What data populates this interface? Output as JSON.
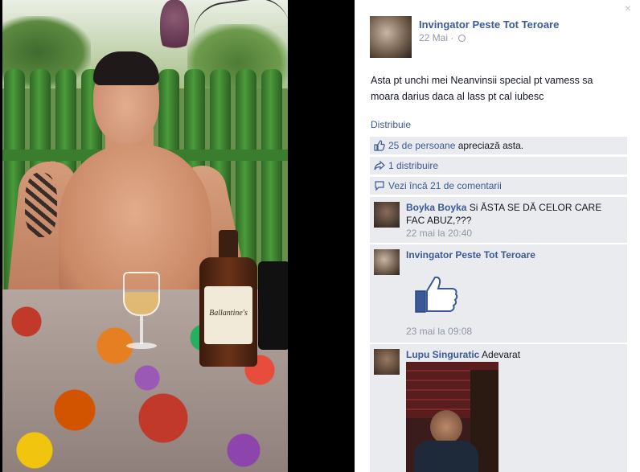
{
  "photo": {
    "bottle_label": "Ballantine's"
  },
  "viewer": {
    "close_glyph": "×"
  },
  "post": {
    "author": "Invingator Peste Tot Teroare",
    "date": "22 Mai",
    "separator": " · ",
    "text": "Asta pt unchi mei Neanvinsii special pt vamess sa moara darius daca al lass pt cal iubesc",
    "share_label": "Distribuie"
  },
  "ufi": {
    "likes_link": "25 de persoane",
    "likes_suffix": " apreciază asta.",
    "shares_label": "1 distribuire",
    "more_comments_label": "Vezi încă 21 de comentarii"
  },
  "comments": [
    {
      "author": "Boyka Boyka",
      "text": " Si ĂSTA SE DĂ CELOR CARE FAC ABUZ,???",
      "time": "22 mai la 20:40"
    },
    {
      "author": "Invingator Peste Tot Teroare",
      "text": "",
      "time": "23 mai la 09:08"
    },
    {
      "author": "Lupu Singuratic",
      "text": " Adevarat",
      "time": ""
    }
  ],
  "colors": {
    "link": "#3b5998",
    "ufi_bg": "#e9ebee",
    "meta": "#9197a3",
    "fence_green": "#3b7d2f"
  }
}
